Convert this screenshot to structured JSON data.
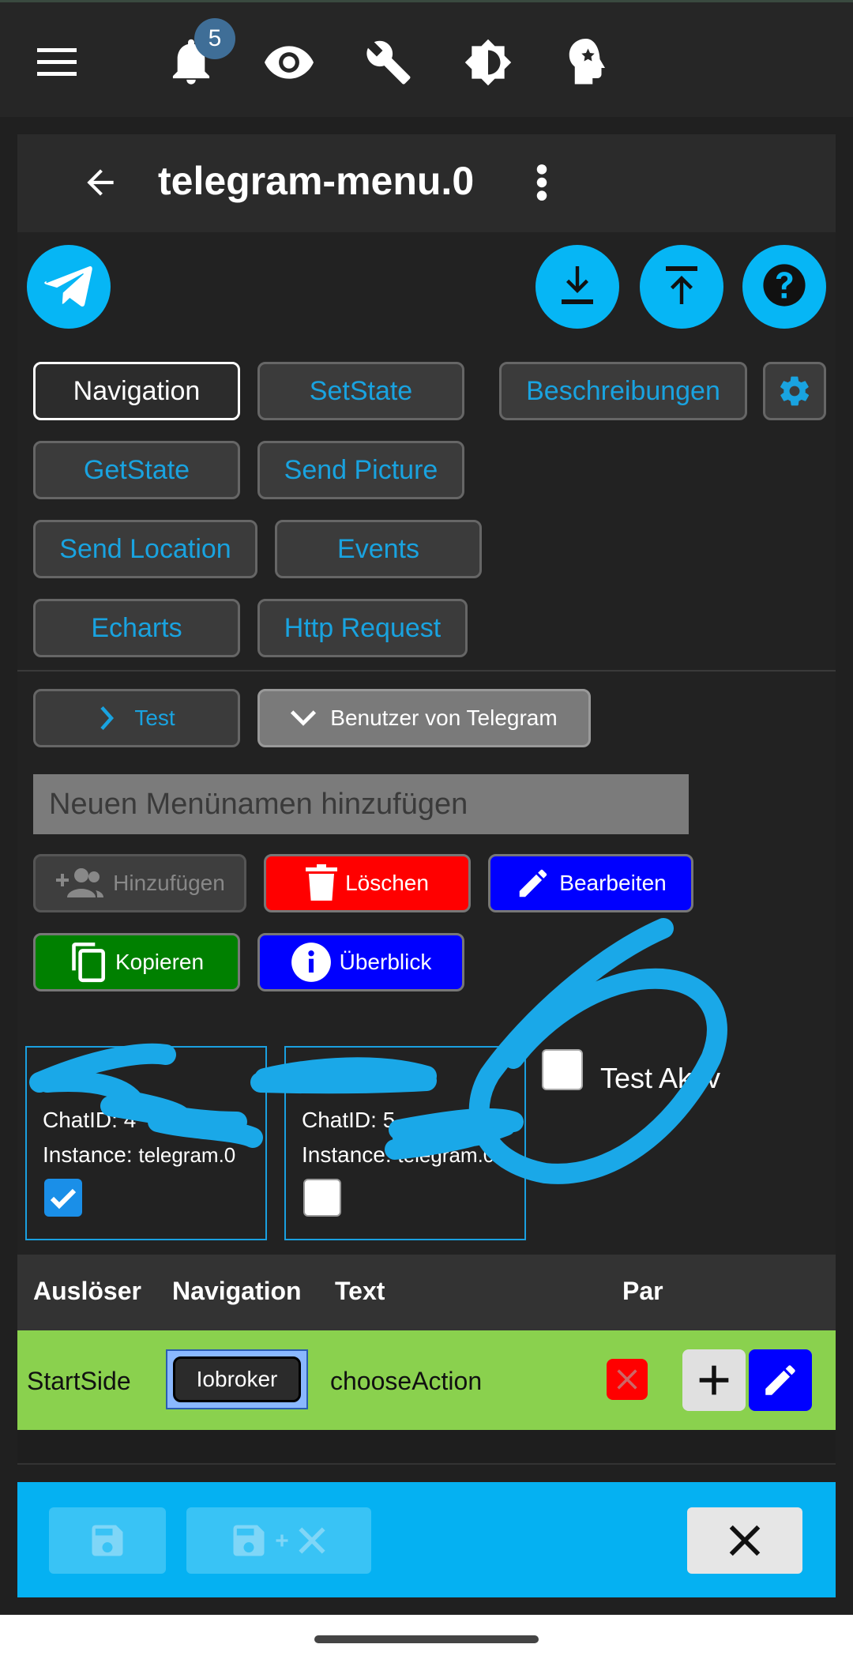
{
  "topbar": {
    "notification_count": "5",
    "icons": [
      "menu-icon",
      "bell-icon",
      "eye-icon",
      "wrench-icon",
      "brightness-icon",
      "expert-mode-icon"
    ]
  },
  "header": {
    "title": "telegram-menu.0"
  },
  "tabs": {
    "navigation": "Navigation",
    "setstate": "SetState",
    "beschreibungen": "Beschreibungen",
    "getstate": "GetState",
    "sendpicture": "Send Picture",
    "sendlocation": "Send Location",
    "events": "Events",
    "echarts": "Echarts",
    "httprequest": "Http Request"
  },
  "groups": {
    "test": "Test",
    "users": "Benutzer von Telegram"
  },
  "menu_input": {
    "placeholder": "Neuen Menünamen hinzufügen"
  },
  "actions": {
    "add": "Hinzufügen",
    "delete": "Löschen",
    "edit": "Bearbeiten",
    "copy": "Kopieren",
    "overview": "Überblick"
  },
  "users": [
    {
      "chatid_label": "ChatID:",
      "chatid_value": "4",
      "instance_label": "Instance:",
      "instance_value": "telegram.0",
      "checked": true
    },
    {
      "chatid_label": "ChatID:",
      "chatid_value": "5",
      "instance_label": "Instance:",
      "instance_value": "telegram.0",
      "checked": false
    }
  ],
  "test_active": {
    "label": "Test Aktiv"
  },
  "table": {
    "headers": [
      "Auslöser",
      "Navigation",
      "Text",
      "Par"
    ],
    "row": {
      "trigger": "StartSide",
      "navigation": "Iobroker",
      "text": "chooseAction"
    }
  },
  "colors": {
    "accent": "#06b6f5",
    "tab_text": "#19a3e0",
    "delete": "#ff0000",
    "edit": "#0000ff",
    "copy": "#008000",
    "row_bg": "#8ad14e"
  }
}
